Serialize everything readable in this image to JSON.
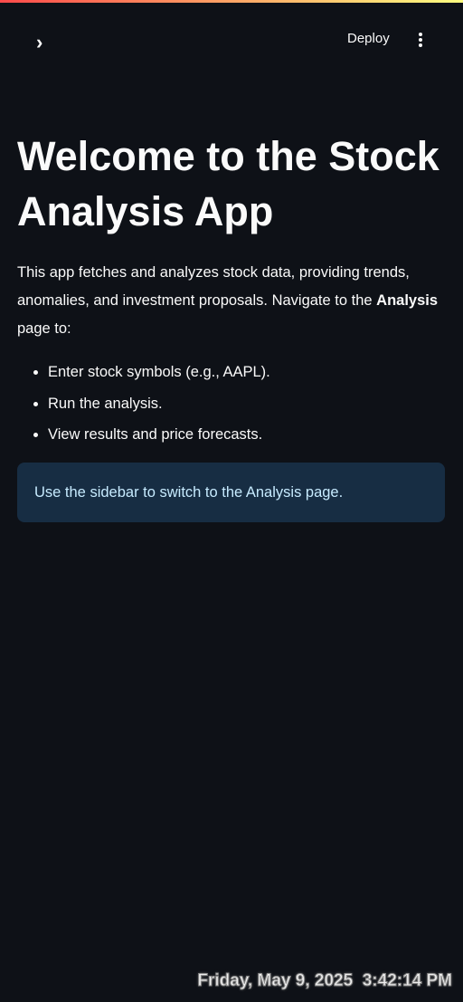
{
  "header": {
    "deploy_label": "Deploy",
    "expand_icon": "chevron-right-icon",
    "menu_icon": "more-vertical-icon"
  },
  "main": {
    "title": "Welcome to the Stock Analysis App",
    "intro_text": "This app fetches and analyzes stock data, providing trends, anomalies, and investment proposals. Navigate to the ",
    "intro_bold": "Analysis",
    "intro_end": " page to:",
    "bullets": [
      "Enter stock symbols (e.g., AAPL).",
      "Run the analysis.",
      "View results and price forecasts."
    ],
    "info": "Use the sidebar to switch to the Analysis page."
  },
  "overlay": {
    "clock": "Friday, May 9, 2025  3:42:14 PM"
  },
  "colors": {
    "background": "#0e1117",
    "info_bg": "#172d43",
    "info_text": "#c7ebff"
  }
}
